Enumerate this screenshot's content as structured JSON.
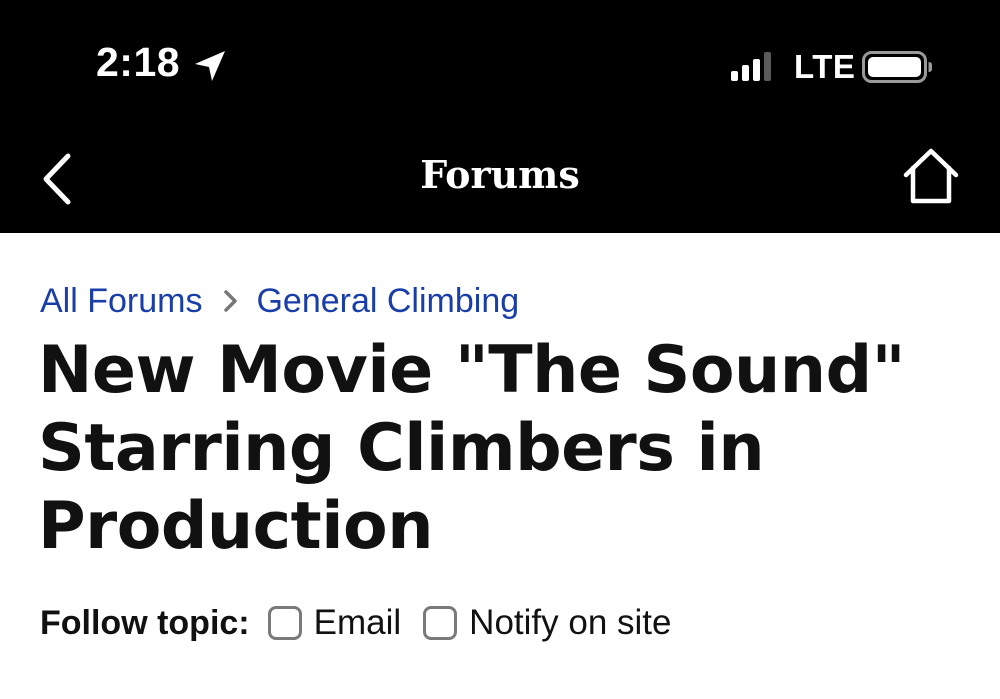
{
  "status_bar": {
    "time": "2:18",
    "network": "LTE"
  },
  "nav": {
    "title": "Forums",
    "back_icon": "chevron-left-icon",
    "home_icon": "home-icon"
  },
  "breadcrumb": {
    "items": [
      "All Forums",
      "General Climbing"
    ],
    "separator_icon": "chevron-right-icon"
  },
  "topic": {
    "title": "New Movie \"The Sound\" Starring Climbers in Production"
  },
  "follow": {
    "label": "Follow topic:",
    "options": [
      {
        "label": "Email",
        "checked": false
      },
      {
        "label": "Notify on site",
        "checked": false
      }
    ]
  },
  "colors": {
    "header_bg": "#000000",
    "link": "#1a3ea8",
    "text": "#111111",
    "checkbox_border": "#7a7a7a"
  }
}
